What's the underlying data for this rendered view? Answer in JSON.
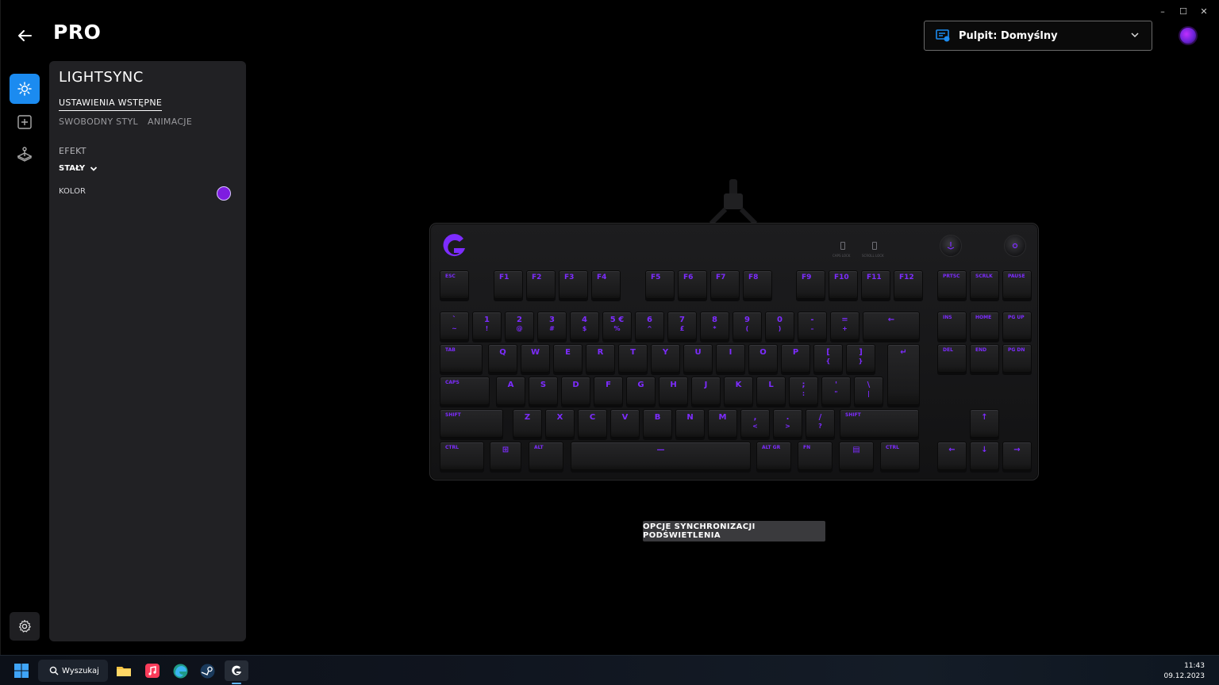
{
  "window": {
    "minimize_label": "–",
    "maximize_label": "☐",
    "close_label": "✕"
  },
  "header": {
    "title": "PRO",
    "profile_label": "Pulpit: Domyślny"
  },
  "panel": {
    "heading": "LIGHTSYNC",
    "tabs": [
      {
        "label": "USTAWIENIA WSTĘPNE",
        "active": true
      },
      {
        "label": "SWOBODNY STYL",
        "active": false
      },
      {
        "label": "ANIMACJE",
        "active": false
      }
    ],
    "effect_label": "EFEKT",
    "effect_value": "STAŁY",
    "color_label": "KOLOR",
    "color_value": "#7e1de0"
  },
  "keyboard": {
    "indicator_labels": [
      "CAPS LOCK",
      "SCROLL LOCK"
    ],
    "rows": [
      [
        {
          "t": "ESC"
        },
        {
          "t": "F1"
        },
        {
          "t": "F2"
        },
        {
          "t": "F3"
        },
        {
          "t": "F4"
        },
        {
          "t": "F5"
        },
        {
          "t": "F6"
        },
        {
          "t": "F7"
        },
        {
          "t": "F8"
        },
        {
          "t": "F9"
        },
        {
          "t": "F10"
        },
        {
          "t": "F11"
        },
        {
          "t": "F12"
        },
        {
          "t": "PRTSC"
        },
        {
          "t": "SCRLK"
        },
        {
          "t": "PAUSE"
        }
      ],
      [
        {
          "t": "`",
          "b": "~"
        },
        {
          "t": "1",
          "b": "!"
        },
        {
          "t": "2",
          "b": "@"
        },
        {
          "t": "3",
          "b": "#"
        },
        {
          "t": "4",
          "b": "$"
        },
        {
          "t": "5 €",
          "b": "%"
        },
        {
          "t": "6",
          "b": "^"
        },
        {
          "t": "7",
          "b": "£"
        },
        {
          "t": "8",
          "b": "*"
        },
        {
          "t": "9",
          "b": "("
        },
        {
          "t": "0",
          "b": ")"
        },
        {
          "t": "-",
          "b": "–"
        },
        {
          "t": "=",
          "b": "+"
        },
        {
          "t": "←"
        },
        {
          "t": "INS"
        },
        {
          "t": "HOME"
        },
        {
          "t": "PG UP"
        }
      ],
      [
        {
          "t": "TAB"
        },
        {
          "t": "Q"
        },
        {
          "t": "W"
        },
        {
          "t": "E"
        },
        {
          "t": "R"
        },
        {
          "t": "T"
        },
        {
          "t": "Y"
        },
        {
          "t": "U"
        },
        {
          "t": "I"
        },
        {
          "t": "O"
        },
        {
          "t": "P"
        },
        {
          "t": "[",
          "b": "{"
        },
        {
          "t": "]",
          "b": "}"
        },
        {
          "t": "↵"
        },
        {
          "t": "DEL"
        },
        {
          "t": "END"
        },
        {
          "t": "PG DN"
        }
      ],
      [
        {
          "t": "CAPS"
        },
        {
          "t": "A"
        },
        {
          "t": "S"
        },
        {
          "t": "D"
        },
        {
          "t": "F"
        },
        {
          "t": "G"
        },
        {
          "t": "H"
        },
        {
          "t": "J"
        },
        {
          "t": "K"
        },
        {
          "t": "L"
        },
        {
          "t": ";",
          "b": ":"
        },
        {
          "t": "'",
          "b": "\""
        },
        {
          "t": "\\",
          "b": "|"
        }
      ],
      [
        {
          "t": "SHIFT"
        },
        {
          "t": "Z"
        },
        {
          "t": "X"
        },
        {
          "t": "C"
        },
        {
          "t": "V"
        },
        {
          "t": "B"
        },
        {
          "t": "N"
        },
        {
          "t": "M"
        },
        {
          "t": ",",
          "b": "<"
        },
        {
          "t": ".",
          "b": ">"
        },
        {
          "t": "/",
          "b": "?"
        },
        {
          "t": "SHIFT"
        },
        {
          "t": "↑"
        }
      ],
      [
        {
          "t": "CTRL"
        },
        {
          "t": "⊞"
        },
        {
          "t": "ALT"
        },
        {
          "t": "—"
        },
        {
          "t": "ALT GR"
        },
        {
          "t": "FN"
        },
        {
          "t": "▤"
        },
        {
          "t": "CTRL"
        },
        {
          "t": "←"
        },
        {
          "t": "↓"
        },
        {
          "t": "→"
        }
      ]
    ]
  },
  "sync_button_label": "OPCJE SYNCHRONIZACJI PODŚWIETLENIA",
  "taskbar": {
    "search_label": "Wyszukaj",
    "time": "11:43",
    "date": "09.12.2023"
  },
  "colors": {
    "accent_blue": "#1b8bf0",
    "key_backlight": "#7d2cff"
  }
}
